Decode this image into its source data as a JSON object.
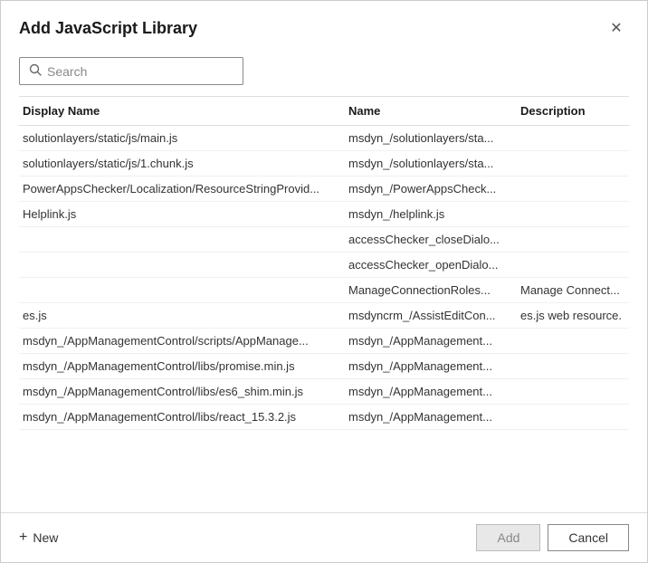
{
  "dialog": {
    "title": "Add JavaScript Library",
    "close_label": "✕"
  },
  "search": {
    "placeholder": "Search",
    "value": ""
  },
  "table": {
    "columns": [
      {
        "key": "display_name",
        "label": "Display Name"
      },
      {
        "key": "name",
        "label": "Name"
      },
      {
        "key": "description",
        "label": "Description"
      }
    ],
    "rows": [
      {
        "display_name": "solutionlayers/static/js/main.js",
        "name": "msdyn_/solutionlayers/sta...",
        "description": ""
      },
      {
        "display_name": "solutionlayers/static/js/1.chunk.js",
        "name": "msdyn_/solutionlayers/sta...",
        "description": ""
      },
      {
        "display_name": "PowerAppsChecker/Localization/ResourceStringProvid...",
        "name": "msdyn_/PowerAppsCheck...",
        "description": ""
      },
      {
        "display_name": "Helplink.js",
        "name": "msdyn_/helplink.js",
        "description": ""
      },
      {
        "display_name": "",
        "name": "accessChecker_closeDialo...",
        "description": ""
      },
      {
        "display_name": "",
        "name": "accessChecker_openDialo...",
        "description": ""
      },
      {
        "display_name": "",
        "name": "ManageConnectionRoles...",
        "description": "Manage Connect..."
      },
      {
        "display_name": "es.js",
        "name": "msdyncrm_/AssistEditCon...",
        "description": "es.js web resource."
      },
      {
        "display_name": "msdyn_/AppManagementControl/scripts/AppManage...",
        "name": "msdyn_/AppManagement...",
        "description": ""
      },
      {
        "display_name": "msdyn_/AppManagementControl/libs/promise.min.js",
        "name": "msdyn_/AppManagement...",
        "description": ""
      },
      {
        "display_name": "msdyn_/AppManagementControl/libs/es6_shim.min.js",
        "name": "msdyn_/AppManagement...",
        "description": ""
      },
      {
        "display_name": "msdyn_/AppManagementControl/libs/react_15.3.2.js",
        "name": "msdyn_/AppManagement...",
        "description": ""
      }
    ]
  },
  "footer": {
    "new_label": "New",
    "add_label": "Add",
    "cancel_label": "Cancel"
  }
}
